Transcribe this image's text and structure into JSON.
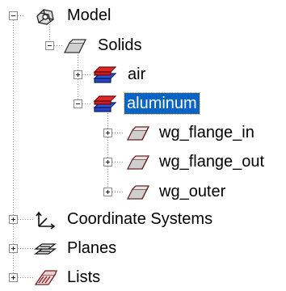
{
  "tree": {
    "model": {
      "label": "Model",
      "icon": "model-icon",
      "expander": "minus"
    },
    "solids": {
      "label": "Solids",
      "icon": "solid-folder-icon",
      "expander": "minus"
    },
    "air": {
      "label": "air",
      "icon": "material-icon",
      "expander": "plus"
    },
    "aluminum": {
      "label": "aluminum",
      "icon": "material-icon",
      "expander": "minus",
      "selected": true
    },
    "wg_flange_in": {
      "label": "wg_flange_in",
      "icon": "solid-part-icon",
      "expander": "plus"
    },
    "wg_flange_out": {
      "label": "wg_flange_out",
      "icon": "solid-part-icon",
      "expander": "plus"
    },
    "wg_outer": {
      "label": "wg_outer",
      "icon": "solid-part-icon",
      "expander": "plus"
    },
    "coordinate_systems": {
      "label": "Coordinate Systems",
      "icon": "coordinate-axes-icon",
      "expander": "plus"
    },
    "planes": {
      "label": "Planes",
      "icon": "planes-icon",
      "expander": "plus"
    },
    "lists": {
      "label": "Lists",
      "icon": "lists-icon",
      "expander": "plus"
    }
  },
  "colors": {
    "selection": "#0a64c8",
    "material_top": "#e02828",
    "material_bottom": "#2a55d8",
    "part_fill": "#c9c9c9",
    "part_stroke": "#7a2a2a"
  }
}
